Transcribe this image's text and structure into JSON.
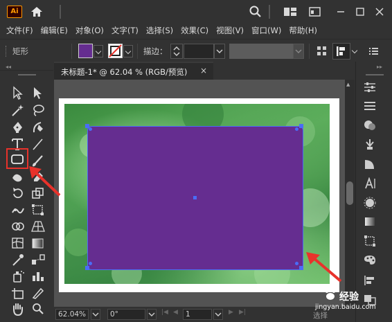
{
  "app": {
    "logo": "Ai"
  },
  "menu": [
    "文件(F)",
    "编辑(E)",
    "对象(O)",
    "文字(T)",
    "选择(S)",
    "效果(C)",
    "视图(V)",
    "窗口(W)",
    "帮助(H)"
  ],
  "control_bar": {
    "shape_label": "矩形",
    "stroke_label": "描边：",
    "fill_color": "#652d90"
  },
  "document": {
    "tab_title": "未标题-1* @ 62.04 % (RGB/预览)",
    "close_glyph": "×"
  },
  "status_bar": {
    "zoom": "62.04%",
    "rotation": "0°",
    "page": "1",
    "selection_label": "选择"
  },
  "watermark": {
    "text": "经验",
    "url": "jingyan.baidu.com"
  },
  "colors": {
    "accent_handle": "#4a6cf7",
    "highlight": "#e8322b",
    "rect_fill": "#652d90"
  }
}
